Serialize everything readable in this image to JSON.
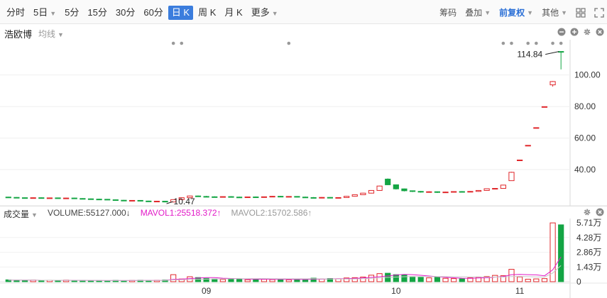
{
  "toolbar": {
    "periods": [
      {
        "label": "分时"
      },
      {
        "label": "5日",
        "caret": "▼"
      },
      {
        "label": "5分"
      },
      {
        "label": "15分"
      },
      {
        "label": "30分"
      },
      {
        "label": "60分"
      },
      {
        "label": "日 K",
        "active": true
      },
      {
        "label": "周 K"
      },
      {
        "label": "月 K"
      },
      {
        "label": "更多",
        "caret": "▼"
      }
    ],
    "right": {
      "chips_label": "筹码",
      "overlay_label": "叠加",
      "adjust_label": "前复权",
      "other_label": "其他"
    }
  },
  "stock": {
    "name": "浩欧博",
    "avg_label": "均线"
  },
  "volume_header": {
    "title": "成交量",
    "volume": "VOLUME:55127.000↓",
    "mavol1": "MAVOL1:25518.372↑",
    "mavol2": "MAVOL2:15702.586↑"
  },
  "colors": {
    "up": "#e0262a",
    "down": "#14a544",
    "ma1": "#e21bc8",
    "active_tab": "#3b7ddd"
  },
  "chart_data": [
    {
      "type": "candlestick",
      "title": "",
      "y_ticks": [
        "100.00",
        "80.00",
        "60.00",
        "40.00"
      ],
      "ylim": [
        18,
        116
      ],
      "annotations": {
        "max_label": "114.84",
        "min_label": "10.47"
      },
      "candles": [
        [
          22.6,
          22.8,
          22.2,
          22.4
        ],
        [
          22.4,
          22.6,
          22.0,
          22.2
        ],
        [
          22.2,
          22.4,
          21.8,
          22.0
        ],
        [
          22.0,
          22.4,
          21.8,
          22.2
        ],
        [
          22.2,
          22.4,
          21.7,
          21.9
        ],
        [
          21.9,
          22.3,
          21.7,
          22.1
        ],
        [
          22.1,
          22.3,
          21.6,
          21.8
        ],
        [
          21.8,
          22.2,
          21.6,
          22.0
        ],
        [
          22.0,
          22.2,
          21.5,
          21.7
        ],
        [
          21.7,
          21.9,
          21.3,
          21.5
        ],
        [
          21.5,
          21.7,
          21.1,
          21.3
        ],
        [
          21.3,
          21.6,
          21.0,
          21.2
        ],
        [
          21.2,
          21.4,
          20.7,
          20.9
        ],
        [
          20.9,
          21.1,
          20.4,
          20.6
        ],
        [
          20.6,
          20.8,
          20.1,
          20.3
        ],
        [
          20.3,
          20.7,
          20.0,
          20.5
        ],
        [
          20.5,
          20.7,
          19.9,
          20.1
        ],
        [
          20.1,
          20.3,
          19.6,
          19.8
        ],
        [
          19.8,
          20.2,
          19.4,
          20.0
        ],
        [
          20.0,
          20.2,
          19.3,
          19.5
        ],
        [
          19.5,
          21.2,
          19.3,
          21.0
        ],
        [
          21.0,
          22.4,
          20.8,
          22.2
        ],
        [
          22.2,
          23.5,
          22.0,
          23.3
        ],
        [
          23.3,
          23.6,
          22.8,
          23.0
        ],
        [
          23.0,
          23.4,
          22.6,
          22.8
        ],
        [
          22.8,
          23.1,
          22.3,
          22.5
        ],
        [
          22.5,
          23.0,
          22.3,
          22.9
        ],
        [
          22.9,
          23.2,
          22.4,
          22.6
        ],
        [
          22.6,
          22.9,
          22.2,
          22.4
        ],
        [
          22.4,
          22.8,
          22.2,
          22.7
        ],
        [
          22.7,
          23.0,
          22.2,
          22.4
        ],
        [
          22.4,
          22.9,
          22.2,
          22.8
        ],
        [
          22.8,
          23.3,
          22.6,
          23.1
        ],
        [
          23.1,
          23.4,
          22.6,
          22.8
        ],
        [
          22.8,
          23.2,
          22.5,
          23.0
        ],
        [
          23.0,
          23.2,
          22.4,
          22.6
        ],
        [
          22.6,
          22.9,
          22.1,
          22.3
        ],
        [
          22.3,
          22.6,
          21.8,
          22.0
        ],
        [
          22.0,
          22.6,
          21.8,
          22.4
        ],
        [
          22.4,
          22.6,
          21.8,
          22.0
        ],
        [
          22.0,
          22.5,
          21.9,
          22.3
        ],
        [
          22.3,
          23.3,
          22.1,
          23.1
        ],
        [
          23.1,
          24.3,
          22.9,
          24.1
        ],
        [
          24.1,
          25.3,
          23.9,
          25.1
        ],
        [
          25.1,
          27.0,
          24.9,
          26.8
        ],
        [
          26.8,
          29.8,
          26.6,
          29.6
        ],
        [
          34.0,
          34.4,
          30.2,
          30.4
        ],
        [
          30.4,
          30.6,
          27.4,
          27.8
        ],
        [
          27.8,
          28.0,
          26.2,
          26.6
        ],
        [
          26.6,
          26.8,
          25.8,
          26.2
        ],
        [
          26.2,
          26.5,
          25.4,
          25.8
        ],
        [
          25.8,
          26.3,
          25.4,
          26.0
        ],
        [
          26.0,
          26.2,
          25.2,
          25.6
        ],
        [
          25.6,
          26.0,
          25.2,
          25.8
        ],
        [
          25.8,
          26.3,
          25.6,
          26.1
        ],
        [
          26.1,
          26.4,
          25.6,
          25.9
        ],
        [
          25.9,
          26.4,
          25.8,
          26.2
        ],
        [
          26.2,
          27.0,
          26.0,
          26.8
        ],
        [
          26.8,
          28.0,
          26.6,
          27.9
        ],
        [
          27.9,
          28.3,
          27.5,
          28.1
        ],
        [
          28.1,
          30.4,
          28.0,
          30.2
        ],
        [
          33.0,
          38.6,
          33.0,
          38.3
        ],
        [
          46.0,
          46.2,
          46.0,
          46.1
        ],
        [
          55.3,
          55.5,
          55.3,
          55.4
        ],
        [
          66.5,
          66.7,
          66.5,
          66.6
        ],
        [
          79.8,
          80.0,
          79.8,
          79.9
        ],
        [
          93.7,
          96.1,
          92.6,
          95.8
        ],
        [
          114.84,
          114.84,
          103.5,
          114.8
        ]
      ]
    },
    {
      "type": "bar",
      "title": "",
      "y_ticks": [
        "5.71万",
        "4.28万",
        "2.86万",
        "1.43万",
        "0"
      ],
      "x_ticks": [
        "09",
        "10",
        "11"
      ],
      "ylim": [
        0,
        57100
      ],
      "volumes": [
        1800,
        1500,
        1300,
        1600,
        1200,
        1400,
        1100,
        1500,
        1000,
        1200,
        900,
        1100,
        1000,
        1300,
        900,
        1200,
        1400,
        1100,
        1300,
        1600,
        6800,
        2600,
        4800,
        4000,
        3200,
        2600,
        2200,
        3000,
        2400,
        1900,
        2700,
        2300,
        2000,
        2500,
        1800,
        2300,
        2100,
        3400,
        2600,
        3100,
        2800,
        3600,
        3900,
        4500,
        6300,
        7800,
        8200,
        6800,
        6600,
        4900,
        4200,
        3700,
        4500,
        3300,
        3000,
        2700,
        3800,
        4300,
        5000,
        6100,
        5800,
        12000,
        4600,
        2400,
        2700,
        3000,
        57000,
        55127
      ],
      "mavol1": [
        1600,
        1600,
        1500,
        1500,
        1400,
        1400,
        1300,
        1300,
        1300,
        1200,
        1200,
        1100,
        1100,
        1100,
        1100,
        1100,
        1200,
        1200,
        1200,
        1300,
        2300,
        2500,
        3000,
        3500,
        4000,
        3900,
        3400,
        3100,
        2900,
        2500,
        2400,
        2500,
        2300,
        2400,
        2200,
        2200,
        2100,
        2400,
        2400,
        2700,
        2800,
        2900,
        3200,
        3600,
        4100,
        4800,
        5600,
        6500,
        7000,
        6800,
        6200,
        5500,
        4800,
        4200,
        3800,
        3400,
        3300,
        3600,
        3800,
        4400,
        5000,
        6800,
        7100,
        6800,
        6600,
        5700,
        11500,
        24000
      ],
      "mavol2": [
        1500,
        1500,
        1500,
        1500,
        1400,
        1400,
        1400,
        1300,
        1300,
        1300,
        1300,
        1200,
        1200,
        1200,
        1200,
        1200,
        1200,
        1200,
        1200,
        1200,
        1700,
        1900,
        2100,
        2300,
        2500,
        2600,
        2700,
        2800,
        2900,
        2900,
        3000,
        3000,
        2900,
        2800,
        2800,
        2800,
        2800,
        2800,
        2700,
        2600,
        2600,
        2600,
        2700,
        2900,
        3300,
        3700,
        4100,
        4500,
        4800,
        4900,
        4900,
        4900,
        4900,
        4900,
        4800,
        4800,
        4700,
        4600,
        4500,
        4500,
        4500,
        5000,
        5100,
        4900,
        4700,
        4500,
        8400,
        15702
      ]
    }
  ]
}
